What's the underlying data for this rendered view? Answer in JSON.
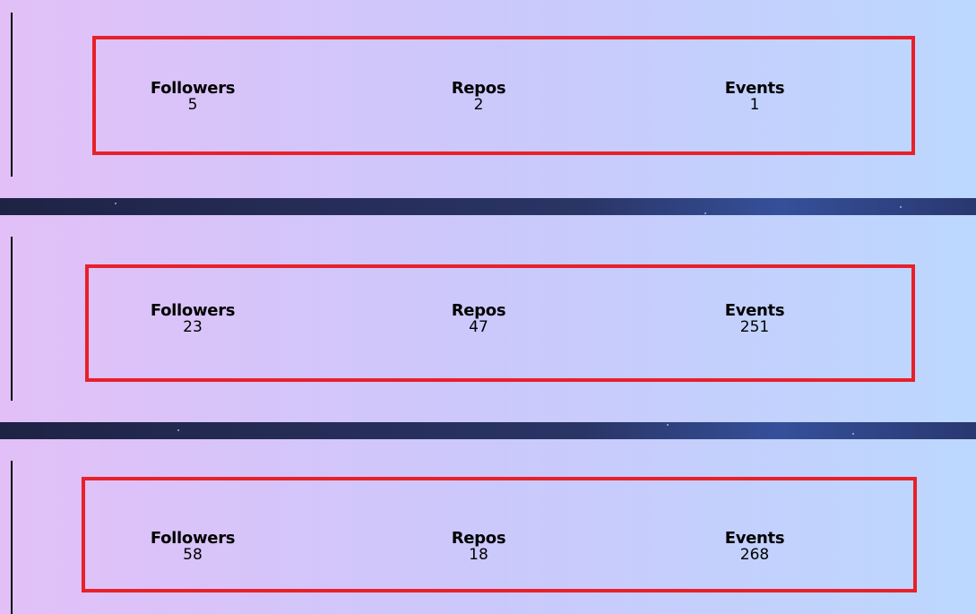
{
  "cards": [
    {
      "stats": [
        {
          "label": "Followers",
          "value": "5"
        },
        {
          "label": "Repos",
          "value": "2"
        },
        {
          "label": "Events",
          "value": "1"
        }
      ]
    },
    {
      "stats": [
        {
          "label": "Followers",
          "value": "23"
        },
        {
          "label": "Repos",
          "value": "47"
        },
        {
          "label": "Events",
          "value": "251"
        }
      ]
    },
    {
      "stats": [
        {
          "label": "Followers",
          "value": "58"
        },
        {
          "label": "Repos",
          "value": "18"
        },
        {
          "label": "Events",
          "value": "268"
        }
      ]
    }
  ],
  "colors": {
    "highlight_border": "#e8202a",
    "gradient_start": "#e2c0f7",
    "gradient_end": "#bcd8fe",
    "divider": "#1f2547"
  }
}
